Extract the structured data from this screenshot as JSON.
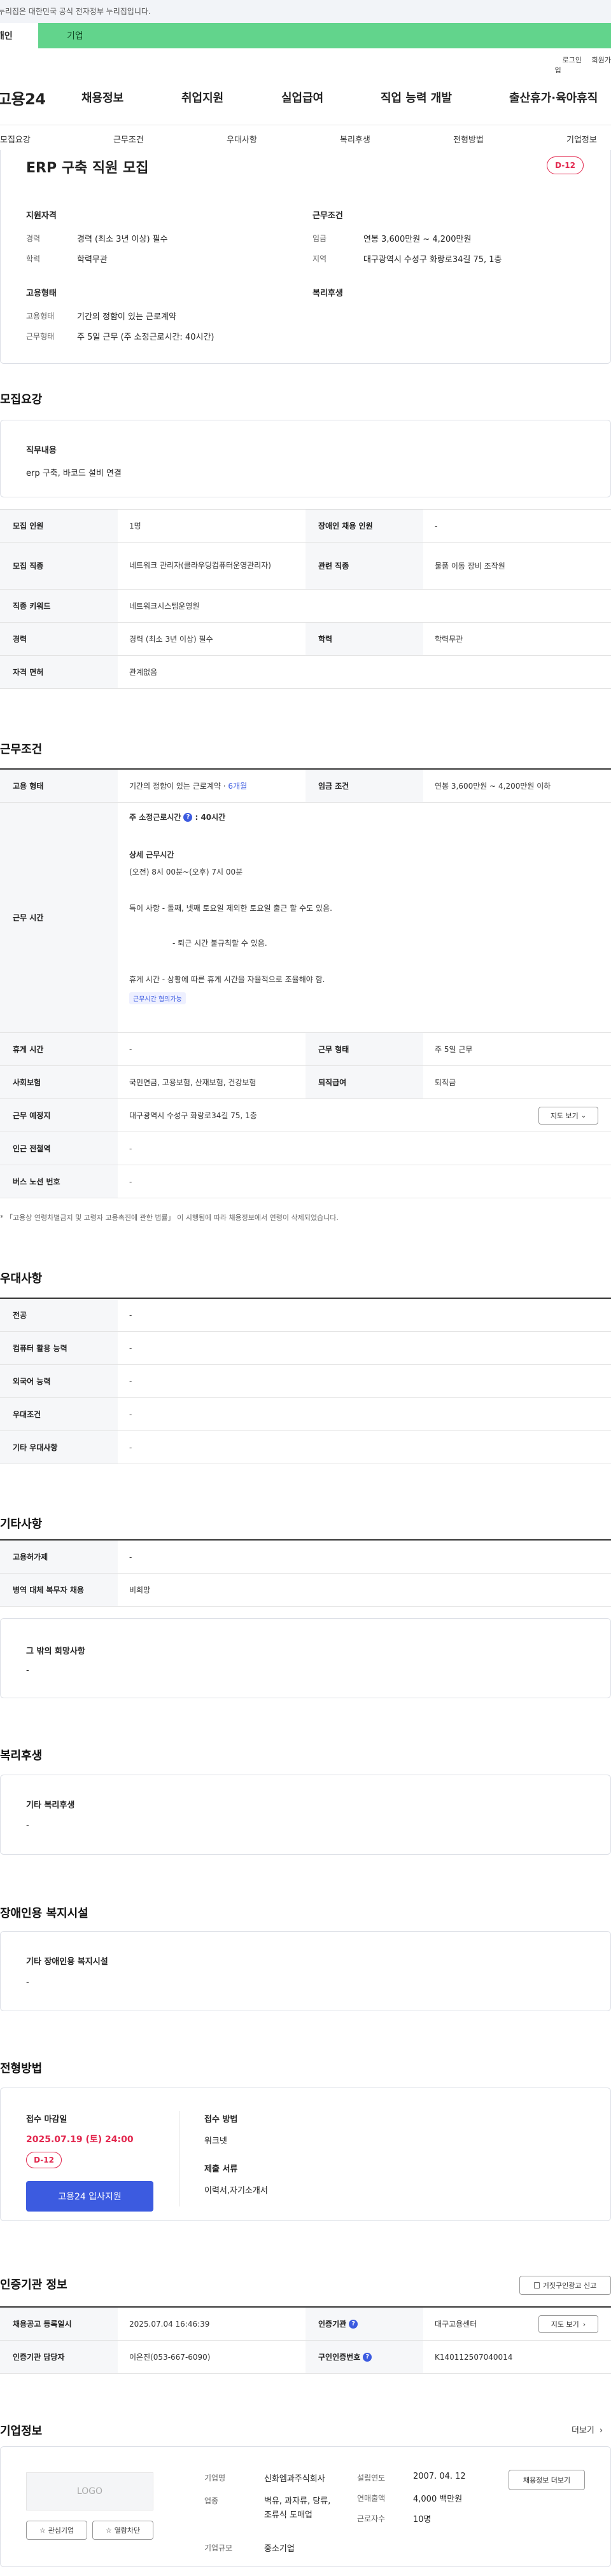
{
  "gov_banner": "이 누리집은 대한민국 공식 전자정부 누리집입니다.",
  "top_tabs": {
    "personal": "개인",
    "company": "기업"
  },
  "util": {
    "login": "로그인",
    "join": "회원가입"
  },
  "logo": "고용24",
  "gnb": [
    "채용정보",
    "취업지원",
    "실업급여",
    "직업 능력 개발",
    "출산휴가·육아휴직"
  ],
  "subnav": [
    "모집요강",
    "근무조건",
    "우대사항",
    "복리후생",
    "전형방법",
    "기업정보"
  ],
  "summary": {
    "title": "ERP 구축 직원 모집",
    "dday": "D-12",
    "qual_head": "지원자격",
    "career_label": "경력",
    "career_value": "경력 (최소 3년 이상) 필수",
    "edu_label": "학력",
    "edu_value": "학력무관",
    "cond_head": "근무조건",
    "wage_label": "임금",
    "wage_value": "연봉 3,600만원 ~ 4,200만원",
    "area_label": "지역",
    "area_value": "대구광역시 수성구 화랑로34길 75, 1층",
    "emp_head": "고용형태",
    "emptype_label": "고용형태",
    "emptype_value": "기간의 정함이 있는 근로계약",
    "worktype_label": "근무형태",
    "worktype_value": "주 5일 근무 (주 소정근로시간: 40시간)",
    "welfare_head": "복리후생"
  },
  "recruit": {
    "title": "모집요강",
    "job_head": "직무내용",
    "job_value": "erp 구축, 바코드 설비 연결",
    "rows": [
      {
        "h1": "모집 인원",
        "v1": "1명",
        "h2": "장애인 채용 인원",
        "v2": "-"
      },
      {
        "h1": "모집 직종",
        "v1": "네트워크 관리자(클라우딩컴퓨터운영관리자)",
        "h2": "관련 직종",
        "v2": "물품 이동 장비 조작원"
      },
      {
        "h1": "직종 키워드",
        "v1": "네트워크시스템운영원"
      },
      {
        "h1": "경력",
        "v1": "경력 (최소 3년 이상) 필수",
        "h2": "학력",
        "v2": "학력무관"
      },
      {
        "h1": "자격 면허",
        "v1": "관계없음"
      }
    ]
  },
  "work": {
    "title": "근무조건",
    "emp_h": "고용 형태",
    "emp_v": "기간의 정함이 있는 근로계약 · ",
    "emp_months": "6개월",
    "wage_h": "임금 조건",
    "wage_v": "연봉 3,600만원 ~ 4,200만원 이하",
    "hours_h": "근무 시간",
    "hours_weekly_label": "주 소정근로시간",
    "hours_weekly_value": ": 40시간",
    "detail_head": "상세 근무시간",
    "detail_time": "(오전) 8시 00분~(오후) 7시 00분",
    "note1": "특이 사항 - 돌째, 넷째 토요일 제외한 토요일 출근 할 수도 있음.",
    "note2": "- 퇴근 시간 불규칙할 수 있음.",
    "note3": "휴게 시간 - 상황에 따른 휴게 시간을 자율적으로 조율해야 함.",
    "chip": "근무시간 협의가능",
    "rest_h": "휴게 시간",
    "rest_v": "-",
    "worktype_h": "근무 형태",
    "worktype_v": "주 5일 근무",
    "ins_h": "사회보험",
    "ins_v": "국민연금, 고용보험, 산재보험, 건강보험",
    "retire_h": "퇴직급여",
    "retire_v": "퇴직금",
    "place_h": "근무 예정지",
    "place_v": "대구광역시 수성구 화랑로34길 75, 1층",
    "map_btn": "지도 보기",
    "station_h": "인근 전철역",
    "station_v": "-",
    "bus_h": "버스 노선 번호",
    "bus_v": "-",
    "footnote": "* 「고용상 연령차별금지 및 고령자 고용촉진에 관한 법률」 이 시행됨에 따라 채용정보에서 연령이 삭제되었습니다."
  },
  "pref": {
    "title": "우대사항",
    "rows": [
      {
        "h": "전공",
        "v": "-"
      },
      {
        "h": "컴퓨터 활용 능력",
        "v": "-"
      },
      {
        "h": "외국어 능력",
        "v": "-"
      },
      {
        "h": "우대조건",
        "v": "-"
      },
      {
        "h": "기타 우대사항",
        "v": "-"
      }
    ]
  },
  "etc": {
    "title": "기타사항",
    "rows": [
      {
        "h": "고용허가제",
        "v": "-"
      },
      {
        "h": "병역 대체 복무자 채용",
        "v": "비희망"
      }
    ],
    "other_head": "그 밖의 희망사항",
    "other_value": "-"
  },
  "welfare": {
    "title": "복리후생",
    "head": "기타 복리후생",
    "value": "-"
  },
  "disability": {
    "title": "장애인용 복지시설",
    "head": "기타 장애인용 복지시설",
    "value": "-"
  },
  "selection": {
    "title": "전형방법",
    "deadline_head": "접수 마감일",
    "deadline_value": "2025.07.19 (토) 24:00",
    "dday": "D-12",
    "apply_btn": "고용24 입사지원",
    "method_head": "접수 방법",
    "method_value": "워크넷",
    "docs_head": "제출 서류",
    "docs_value": "이력서,자기소개서"
  },
  "cert": {
    "title": "인증기관 정보",
    "report_btn": "거짓구인광고 신고",
    "reg_h": "채용공고 등록일시",
    "reg_v": "2025.07.04 16:46:39",
    "org_h": "인증기관",
    "org_v": "대구고용센터",
    "map_btn": "지도 보기",
    "mgr_h": "인증기관 담당자",
    "mgr_v": "이은진(053-667-6090)",
    "no_h": "구인인증번호",
    "no_v": "K140112507040014"
  },
  "company": {
    "title": "기업정보",
    "more": "더보기",
    "logo_text": "LOGO",
    "interest_btn": "관심기업",
    "block_btn": "열람차단",
    "name_label": "기업명",
    "name_value": "신화엠과주식회사",
    "biz_label": "업종",
    "biz_value": "벽유, 과자류, 당류, 조류식 도매업",
    "size_label": "기업규모",
    "size_value": "중소기업",
    "est_label": "설립연도",
    "est_value": "2007. 04. 12",
    "sales_label": "연매출액",
    "sales_value": "4,000 백만원",
    "emp_label": "근로자수",
    "emp_value": "10명",
    "jobs_btn": "채용정보 더보기"
  }
}
